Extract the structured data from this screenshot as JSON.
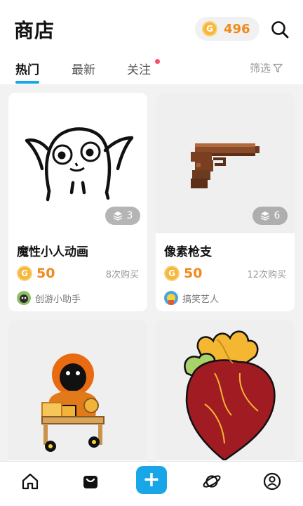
{
  "header": {
    "title": "商店",
    "coin_symbol": "G",
    "coins": "496"
  },
  "tabs": [
    {
      "label": "热门",
      "active": true
    },
    {
      "label": "最新",
      "active": false
    },
    {
      "label": "关注",
      "active": false,
      "has_dot": true
    }
  ],
  "filter": {
    "label": "筛选",
    "icon": "filter-icon"
  },
  "colors": {
    "accent": "#19a6e8",
    "price": "#f08a1c",
    "dot": "#ff4d6a"
  },
  "items": [
    {
      "title": "魔性小人动画",
      "price": "50",
      "sales": "8次购买",
      "author": "创游小助手",
      "layers": "3",
      "icon": "ghost-doodle"
    },
    {
      "title": "像素枪支",
      "price": "50",
      "sales": "12次购买",
      "author": "搞笑艺人",
      "layers": "6",
      "icon": "pixel-pistol"
    },
    {
      "title": "",
      "icon": "hooded-kid-in-cart"
    },
    {
      "title": "",
      "icon": "anatomical-heart"
    }
  ],
  "nav": [
    "home-icon",
    "shop-bag-icon",
    "add-icon",
    "planet-icon",
    "profile-icon"
  ]
}
